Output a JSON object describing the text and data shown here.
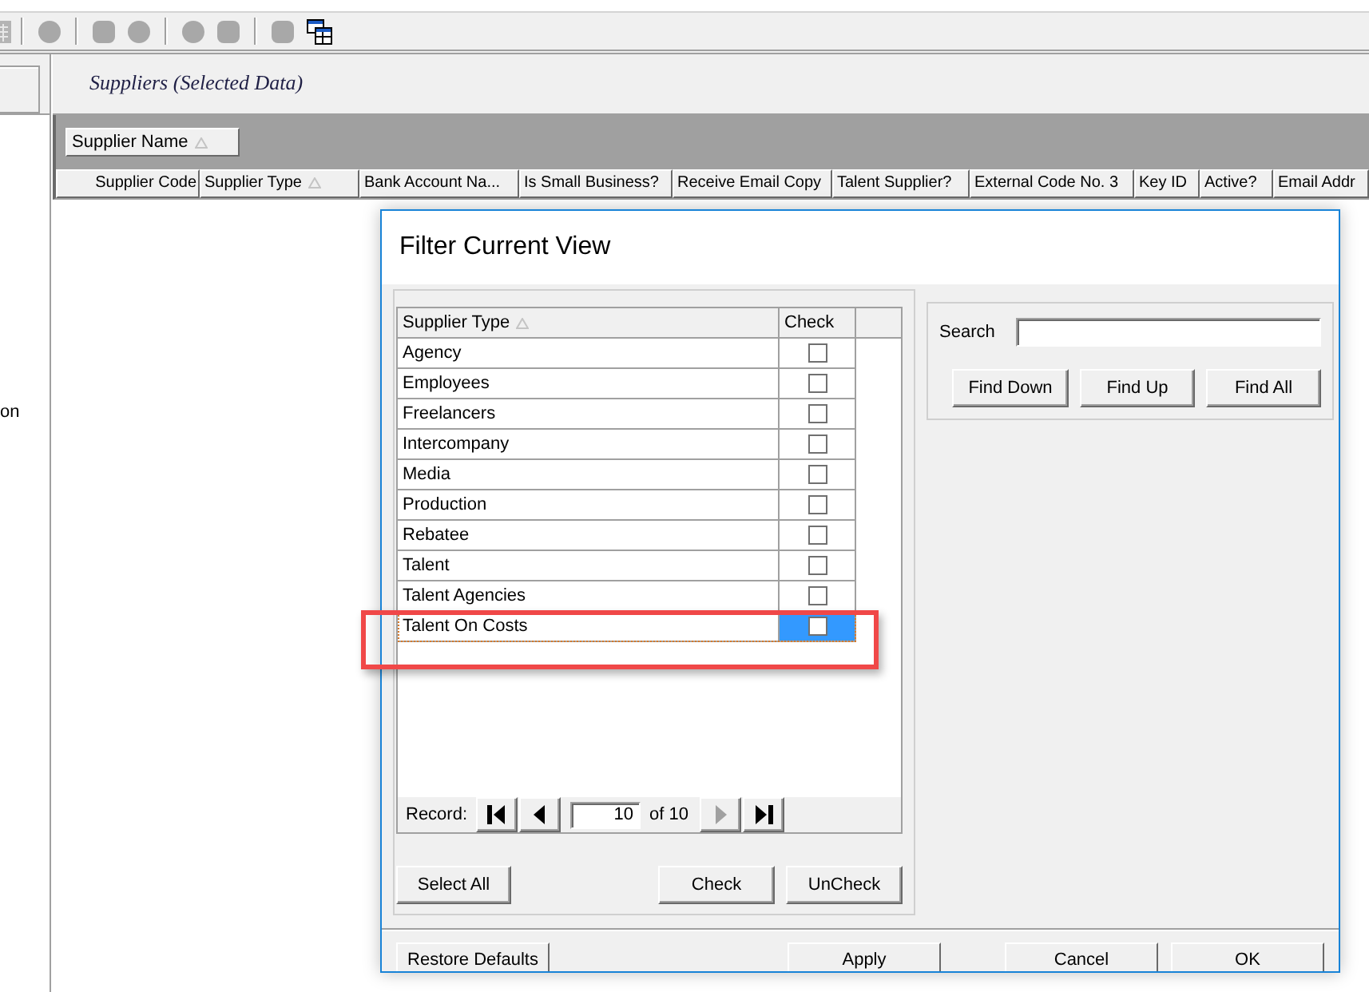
{
  "toolbar": {
    "groups": [
      {
        "buttons": [
          {
            "disabled": true
          }
        ]
      },
      {
        "buttons": [
          {
            "disabled": true
          }
        ]
      },
      {
        "buttons": [
          {
            "disabled": true
          },
          {
            "disabled": true
          }
        ]
      },
      {
        "buttons": [
          {
            "disabled": true
          },
          {
            "disabled": true
          }
        ]
      },
      {
        "buttons": [
          {
            "disabled": true
          },
          {
            "disabled": false
          }
        ]
      }
    ]
  },
  "left_panel": {
    "label_cut": "on"
  },
  "view_title": "Suppliers (Selected Data)",
  "group_by": [
    {
      "label": "Supplier Name",
      "sorted": true
    }
  ],
  "table": {
    "columns": [
      {
        "label": "Supplier Code",
        "sorted": false
      },
      {
        "label": "Supplier Type",
        "sorted": true
      },
      {
        "label": "Bank Account Na...",
        "sorted": false
      },
      {
        "label": "Is Small Business?",
        "sorted": false
      },
      {
        "label": "Receive Email Copy",
        "sorted": false
      },
      {
        "label": "Talent Supplier?",
        "sorted": false
      },
      {
        "label": "External Code No. 3",
        "sorted": false
      },
      {
        "label": "Key ID",
        "sorted": false
      },
      {
        "label": "Active?",
        "sorted": false
      },
      {
        "label": "Email Addr",
        "sorted": false
      }
    ]
  },
  "dialog": {
    "title": "Filter Current View",
    "grid": {
      "columns": [
        {
          "label": "Supplier Type",
          "sorted": true
        },
        {
          "label": "Check",
          "sorted": false
        }
      ],
      "rows": [
        {
          "label": "Agency",
          "checked": false,
          "selected": false,
          "annotated": false
        },
        {
          "label": "Employees",
          "checked": false,
          "selected": false,
          "annotated": false
        },
        {
          "label": "Freelancers",
          "checked": false,
          "selected": false,
          "annotated": false
        },
        {
          "label": "Intercompany",
          "checked": false,
          "selected": false,
          "annotated": false
        },
        {
          "label": "Media",
          "checked": false,
          "selected": false,
          "annotated": false
        },
        {
          "label": "Production",
          "checked": false,
          "selected": false,
          "annotated": false
        },
        {
          "label": "Rebatee",
          "checked": false,
          "selected": false,
          "annotated": false
        },
        {
          "label": "Talent",
          "checked": false,
          "selected": false,
          "annotated": false
        },
        {
          "label": "Talent Agencies",
          "checked": false,
          "selected": false,
          "annotated": false
        },
        {
          "label": "Talent On Costs",
          "checked": false,
          "selected": true,
          "annotated": true
        }
      ]
    },
    "record_navigator": {
      "label": "Record:",
      "value": "10",
      "total": "of 10",
      "buttons": [
        {
          "kind": "first",
          "disabled": false
        },
        {
          "kind": "previous",
          "disabled": false
        },
        {
          "kind": "next",
          "disabled": true
        },
        {
          "kind": "last",
          "disabled": false
        }
      ]
    },
    "list_buttons": [
      "Select All",
      "Check",
      "UnCheck"
    ],
    "search": {
      "label": "Search",
      "buttons": [
        "Find Down",
        "Find Up",
        "Find All"
      ]
    },
    "footer_buttons": [
      "Restore Defaults",
      "Apply",
      "Cancel",
      "OK"
    ]
  }
}
